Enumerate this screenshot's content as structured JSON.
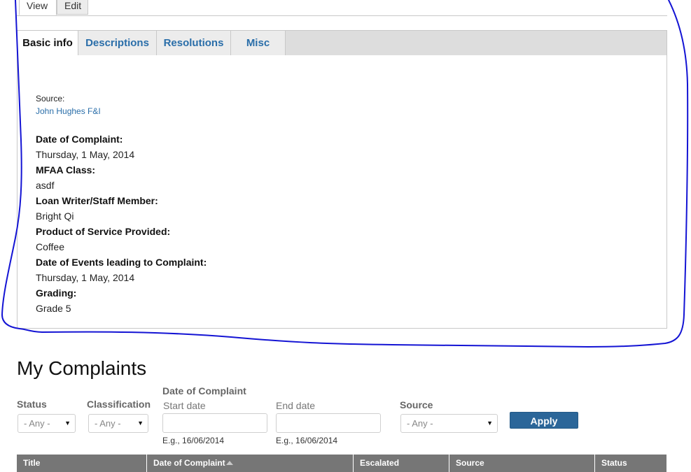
{
  "primary_tabs": [
    {
      "label": "View",
      "active": true
    },
    {
      "label": "Edit",
      "active": false
    }
  ],
  "vertical_tabs": [
    {
      "label": "Basic info",
      "active": true
    },
    {
      "label": "Descriptions",
      "active": false
    },
    {
      "label": "Resolutions",
      "active": false
    },
    {
      "label": "Misc",
      "active": false
    }
  ],
  "basic_info": {
    "source_label": "Source:",
    "source_value": "John Hughes F&I",
    "fields": [
      {
        "label": "Date of Complaint:",
        "value": "Thursday, 1 May, 2014"
      },
      {
        "label": "MFAA Class:",
        "value": "asdf"
      },
      {
        "label": "Loan Writer/Staff Member:",
        "value": "Bright Qi"
      },
      {
        "label": "Product of Service Provided:",
        "value": "Coffee"
      },
      {
        "label": "Date of Events leading to Complaint:",
        "value": "Thursday, 1 May, 2014"
      },
      {
        "label": "Grading:",
        "value": "Grade 5"
      }
    ]
  },
  "annotation": {
    "color": "#1414d4"
  },
  "complaints": {
    "title": "My Complaints",
    "filters": {
      "status": {
        "label": "Status",
        "selected": "- Any -"
      },
      "classification": {
        "label": "Classification",
        "selected": "- Any -"
      },
      "date_group_label": "Date of Complaint",
      "start_date": {
        "label": "Start date",
        "value": "",
        "hint": "E.g., 16/06/2014"
      },
      "end_date": {
        "label": "End date",
        "value": "",
        "hint": "E.g., 16/06/2014"
      },
      "source": {
        "label": "Source",
        "selected": "- Any -"
      },
      "apply_label": "Apply"
    },
    "table": {
      "columns": [
        "Title",
        "Date of Complaint",
        "Escalated",
        "Source",
        "Status"
      ],
      "sorted_column": "Date of Complaint",
      "sort_direction": "ascending"
    }
  },
  "colors": {
    "link": "#2a6ea9",
    "button": "#2b6699",
    "table_header": "#767676"
  }
}
